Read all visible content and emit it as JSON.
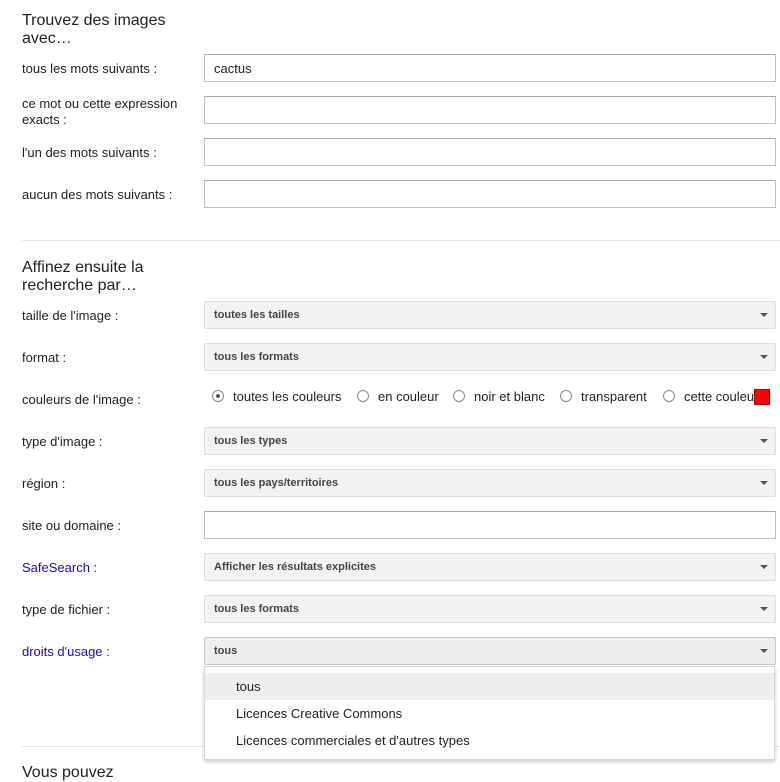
{
  "section1": {
    "heading_line1": "Trouvez des images",
    "heading_line2": "avec…",
    "all_words": {
      "label": "tous les mots suivants :",
      "value": "cactus"
    },
    "exact_phrase": {
      "label_line1": "ce mot ou cette expression",
      "label_line2": "exacts :",
      "value": ""
    },
    "any_words": {
      "label": "l'un des mots suivants :",
      "value": ""
    },
    "none_words": {
      "label": "aucun des mots suivants :",
      "value": ""
    }
  },
  "section2": {
    "heading_line1": "Affinez ensuite la",
    "heading_line2": "recherche par…",
    "image_size": {
      "label": "taille de l'image :",
      "value": "toutes les tailles"
    },
    "aspect_ratio": {
      "label": "format :",
      "value": "tous les formats"
    },
    "image_colors": {
      "label": "couleurs de l'image :",
      "options": [
        "toutes les couleurs",
        "en couleur",
        "noir et blanc",
        "transparent",
        "cette couleur"
      ],
      "selected": "toutes les couleurs",
      "swatch_color": "#ff0000"
    },
    "image_type": {
      "label": "type d'image :",
      "value": "tous les types"
    },
    "region": {
      "label": "région :",
      "value": "tous les pays/territoires"
    },
    "site_domain": {
      "label": "site ou domaine :",
      "value": ""
    },
    "safesearch": {
      "label": "SafeSearch :",
      "value": "Afficher les résultats explicites"
    },
    "file_type": {
      "label": "type de fichier :",
      "value": "tous les formats"
    },
    "usage_rights": {
      "label": "droits d'usage :",
      "value": "tous",
      "options": [
        "tous",
        "Licences Creative Commons",
        "Licences commerciales et d'autres types"
      ]
    }
  },
  "section3": {
    "heading_partial": "Vous pouvez"
  },
  "colors": {
    "link": "#1a0dab",
    "select_bg": "#f2f2f2",
    "highlight": "#eeeeee"
  }
}
